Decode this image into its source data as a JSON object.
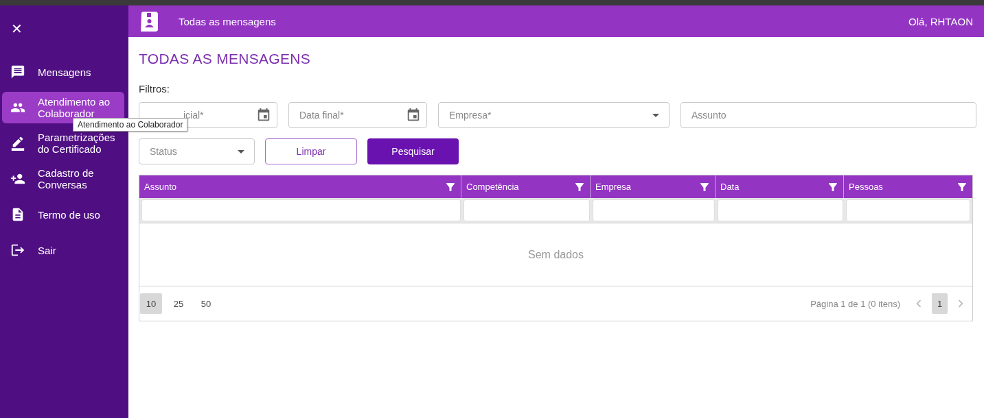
{
  "sidebar": {
    "close_label": "✕",
    "items": [
      {
        "label": "Mensagens",
        "selected": false
      },
      {
        "label": "Atendimento ao Colaborador",
        "selected": true
      },
      {
        "label": "Parametrizações do Certificado",
        "selected": false
      },
      {
        "label": "Cadastro de Conversas",
        "selected": false
      },
      {
        "label": "Termo de uso",
        "selected": false
      },
      {
        "label": "Sair",
        "selected": false
      }
    ]
  },
  "tooltip": "Atendimento ao Colaborador",
  "header": {
    "title": "Todas as mensagens",
    "greeting": "Olá, RHTAON"
  },
  "page_title": "TODAS AS MENSAGENS",
  "filters_label": "Filtros:",
  "filters": [
    {
      "kind": "date",
      "placeholder": "icial*"
    },
    {
      "kind": "date",
      "placeholder": "Data final*"
    },
    {
      "kind": "select",
      "placeholder": "Empresa*"
    },
    {
      "kind": "text",
      "placeholder": "Assunto"
    }
  ],
  "status_filter": {
    "placeholder": "Status"
  },
  "buttons": [
    {
      "label": "Limpar",
      "kind": "outline"
    },
    {
      "label": "Pesquisar",
      "kind": "primary"
    }
  ],
  "table": {
    "columns": [
      "Assunto",
      "Competência",
      "Empresa",
      "Data",
      "Pessoas"
    ],
    "empty_text": "Sem dados",
    "page_sizes": [
      {
        "label": "10",
        "selected": true
      },
      {
        "label": "25",
        "selected": false
      },
      {
        "label": "50",
        "selected": false
      }
    ],
    "page_info": "Página 1 de 1 (0 itens)",
    "pages": [
      {
        "label": "1",
        "selected": true
      }
    ]
  }
}
